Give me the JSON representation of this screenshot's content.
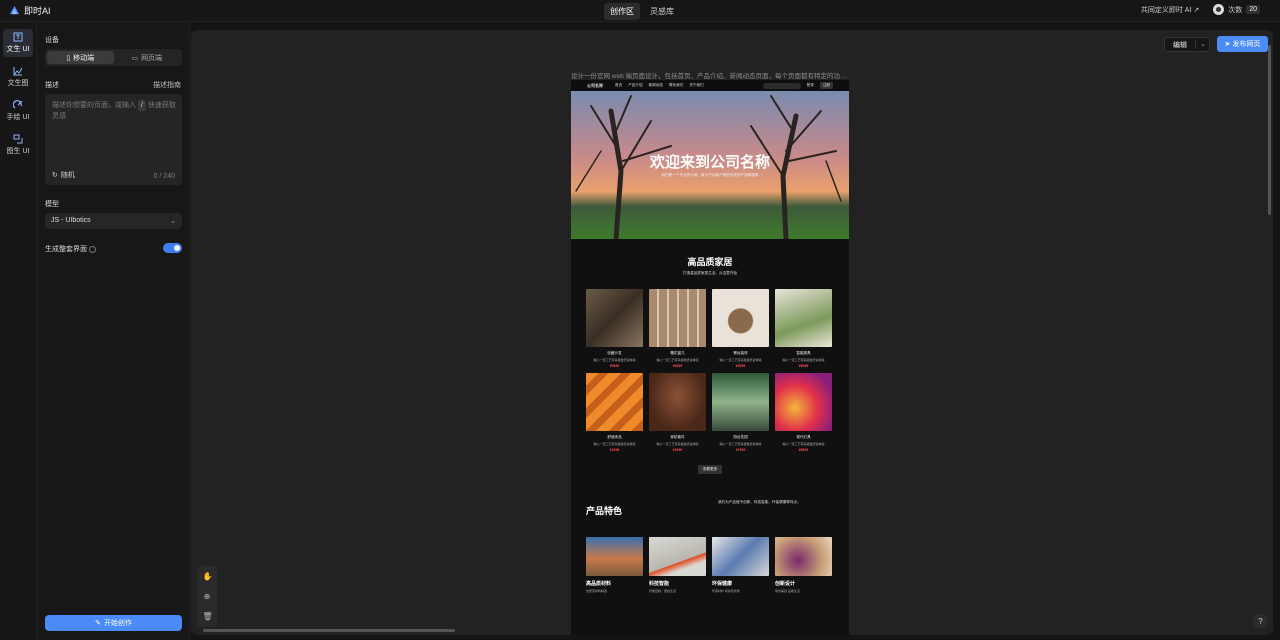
{
  "app": {
    "name": "即时AI",
    "brand_color": "#4a8bf7"
  },
  "top_tabs": [
    {
      "label": "创作区",
      "active": true
    },
    {
      "label": "灵感库",
      "active": false
    }
  ],
  "top_right": {
    "link_label": "共同定义即时 AI ↗",
    "credits_label": "次数",
    "credits_value": "20"
  },
  "left_nav": [
    {
      "label": "文生 UI",
      "icon": "text-to-ui-icon",
      "active": true
    },
    {
      "label": "文生图",
      "icon": "text-to-image-icon",
      "active": false
    },
    {
      "label": "手绘 UI",
      "icon": "sketch-ui-icon",
      "active": false
    },
    {
      "label": "图生 UI",
      "icon": "image-to-ui-icon",
      "active": false
    }
  ],
  "panel": {
    "device_label": "设备",
    "device_options": [
      {
        "label": "移动端",
        "active": true
      },
      {
        "label": "网页端",
        "active": false
      }
    ],
    "desc_label": "描述",
    "desc_guide": "描述指南",
    "desc_placeholder_1": "描述你想要的页面，或输入",
    "desc_placeholder_key": "/",
    "desc_placeholder_2": "快速获取灵感",
    "random_label": "随机",
    "char_count": "0 / 240",
    "model_label": "模型",
    "model_value": "JS - UIbotics",
    "full_page_label": "生成整套界面",
    "full_page_on": true,
    "start_label": "开始创作"
  },
  "canvas": {
    "edit_label": "编辑",
    "publish_label": "发布网页",
    "prompt": "设计一份官网 web 端页面设计，包括首页、产品介绍、新闻动态页面，每个页面都有特定的功能..."
  },
  "preview": {
    "nav": {
      "brand": "公司名称",
      "links": [
        "首页",
        "产品介绍",
        "新闻动态",
        "联系我们",
        "关于我们"
      ],
      "search": "搜索",
      "login": "登录",
      "register": "注册"
    },
    "hero": {
      "title": "欢迎来到公司名称",
      "subtitle": "我们是一个专业的公司，致力于为客户提供优质的产品和服务"
    },
    "products": {
      "title": "高品质家居",
      "subtitle": "打造高品质家居生活，从这里开始",
      "items": [
        {
          "name": "收藏沙发",
          "desc": "精心一流工艺带来极致舒适体验",
          "price": "¥9999"
        },
        {
          "name": "雕花窗几",
          "desc": "精心一流工艺带来极致舒适体验",
          "price": "¥8999"
        },
        {
          "name": "餐台装饰",
          "desc": "精心一流工艺带来极致舒适体验",
          "price": "¥2999"
        },
        {
          "name": "智能厨具",
          "desc": "精心一流工艺带来极致舒适体验",
          "price": "¥6999"
        },
        {
          "name": "舒适床品",
          "desc": "精心一流工艺带来极致舒适体验",
          "price": "¥4999"
        },
        {
          "name": "家纺套件",
          "desc": "精心一流工艺带来极致舒适体验",
          "price": "¥4999"
        },
        {
          "name": "阳台花园",
          "desc": "精心一流工艺带来极致舒适体验",
          "price": "¥7999"
        },
        {
          "name": "现代灯具",
          "desc": "精心一流工艺带来极致舒适体验",
          "price": "¥8999"
        }
      ],
      "more": "查看更多"
    },
    "features": {
      "title": "产品特色",
      "subtitle": "我们为产品赋予创新、科技智能、环保健康等特点。",
      "items": [
        {
          "name": "高品质材料",
          "desc": "优质原材料精选"
        },
        {
          "name": "科技智能",
          "desc": "智能控制，便捷生活"
        },
        {
          "name": "环保健康",
          "desc": "环保材料 呵护您的家"
        },
        {
          "name": "创新设计",
          "desc": "简约美观 品味生活"
        }
      ]
    }
  }
}
